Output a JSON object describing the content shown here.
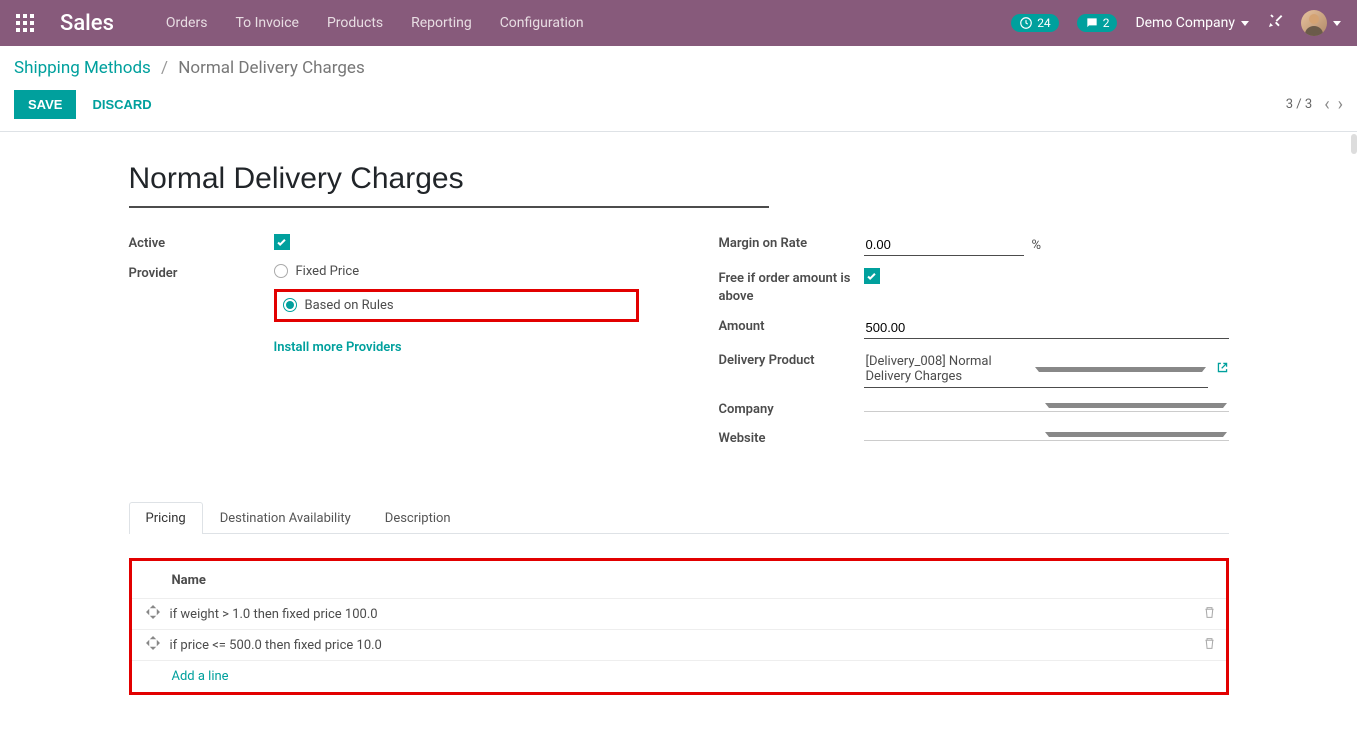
{
  "nav": {
    "brand": "Sales",
    "items": [
      "Orders",
      "To Invoice",
      "Products",
      "Reporting",
      "Configuration"
    ],
    "clock_badge": "24",
    "chat_badge": "2",
    "company": "Demo Company"
  },
  "breadcrumb": {
    "root": "Shipping Methods",
    "sep": "/",
    "current": "Normal Delivery Charges"
  },
  "actions": {
    "save": "SAVE",
    "discard": "DISCARD",
    "pager": "3 / 3"
  },
  "form": {
    "title": "Normal Delivery Charges",
    "left": {
      "active_label": "Active",
      "provider_label": "Provider",
      "provider_options": {
        "fixed": "Fixed Price",
        "rules": "Based on Rules"
      },
      "install_more": "Install more Providers"
    },
    "right": {
      "margin_label": "Margin on Rate",
      "margin_value": "0.00",
      "pct": "%",
      "free_if_label": "Free if order amount is above",
      "amount_label": "Amount",
      "amount_value": "500.00",
      "delivery_product_label": "Delivery Product",
      "delivery_product_value": "[Delivery_008] Normal Delivery Charges",
      "company_label": "Company",
      "website_label": "Website"
    }
  },
  "tabs": [
    "Pricing",
    "Destination Availability",
    "Description"
  ],
  "table": {
    "header": "Name",
    "rules": [
      "if weight > 1.0 then fixed price 100.0",
      "if price <= 500.0 then fixed price 10.0"
    ],
    "add_line": "Add a line"
  }
}
